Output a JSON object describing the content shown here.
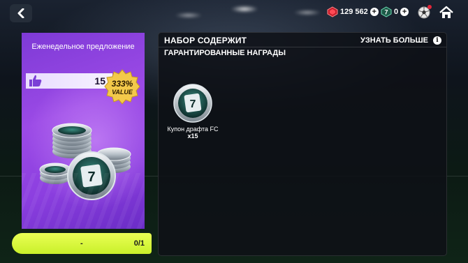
{
  "topbar": {
    "gems_value": "129 562",
    "tokens_value": "0"
  },
  "offer": {
    "title": "Еженедельное предложение",
    "quantity": "15",
    "badge_percent": "333%",
    "badge_text": "VALUE",
    "claim_price": "-",
    "claim_count": "0/1"
  },
  "panel": {
    "header": "НАБОР СОДЕРЖИТ",
    "learn_more": "УЗНАТЬ БОЛЬШЕ",
    "guaranteed_label": "ГАРАНТИРОВАННЫЕ НАГРАДЫ",
    "rewards": [
      {
        "name": "Купон драфта FC",
        "qty": "x15"
      }
    ]
  },
  "icons": {
    "back": "chevron-left-icon",
    "gems": "red-gem-icon",
    "tokens": "token-7-icon",
    "ball": "football-icon",
    "home": "home-icon",
    "info": "info-icon",
    "thumb": "thumbs-up-icon"
  },
  "colors": {
    "accent_claim": "#d6f53a",
    "offer_purple": "#8c3fe0",
    "badge_gold": "#f3c94a"
  }
}
